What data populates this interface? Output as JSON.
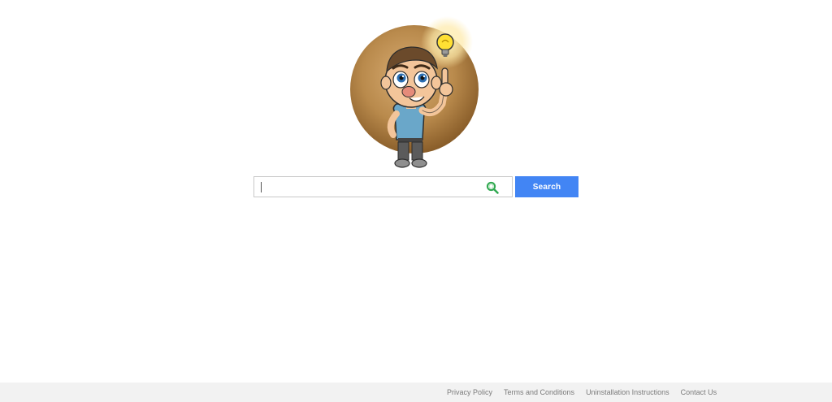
{
  "logo": {
    "icon": "cartoon-man-lightbulb-logo",
    "accent_color": "#b07a3a"
  },
  "search": {
    "value": "",
    "placeholder": "",
    "icon": "search-icon",
    "icon_color": "#2fa84f",
    "button_label": "Search",
    "button_color": "#4285f4"
  },
  "footer": {
    "background": "#f2f2f2",
    "links": [
      {
        "label": "Privacy Policy"
      },
      {
        "label": "Terms and Conditions"
      },
      {
        "label": "Uninstallation Instructions"
      },
      {
        "label": "Contact Us"
      }
    ]
  }
}
